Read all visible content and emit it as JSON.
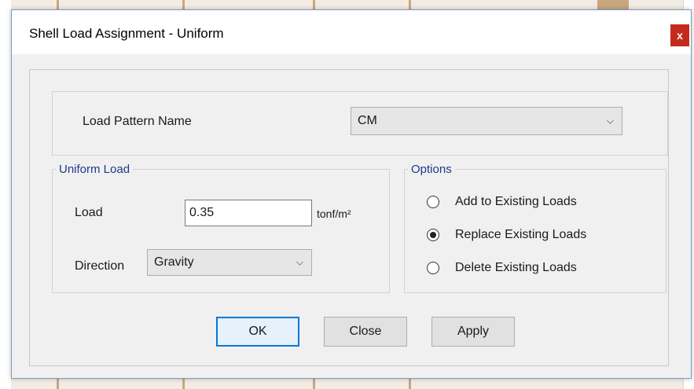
{
  "window": {
    "title": "Shell Load Assignment - Uniform",
    "close_label": "x"
  },
  "load_pattern": {
    "label": "Load Pattern Name",
    "selected": "CM"
  },
  "uniform_load": {
    "legend": "Uniform Load",
    "load_label": "Load",
    "load_value": "0.35",
    "load_unit": "tonf/m²",
    "direction_label": "Direction",
    "direction_selected": "Gravity"
  },
  "options": {
    "legend": "Options",
    "items": [
      {
        "label": "Add to Existing Loads",
        "checked": false
      },
      {
        "label": "Replace Existing Loads",
        "checked": true
      },
      {
        "label": "Delete Existing Loads",
        "checked": false
      }
    ]
  },
  "buttons": {
    "ok": "OK",
    "close": "Close",
    "apply": "Apply"
  },
  "colors": {
    "close_button": "#c42b1c",
    "legend_text": "#1c3a8c",
    "default_button_border": "#0078d7"
  }
}
